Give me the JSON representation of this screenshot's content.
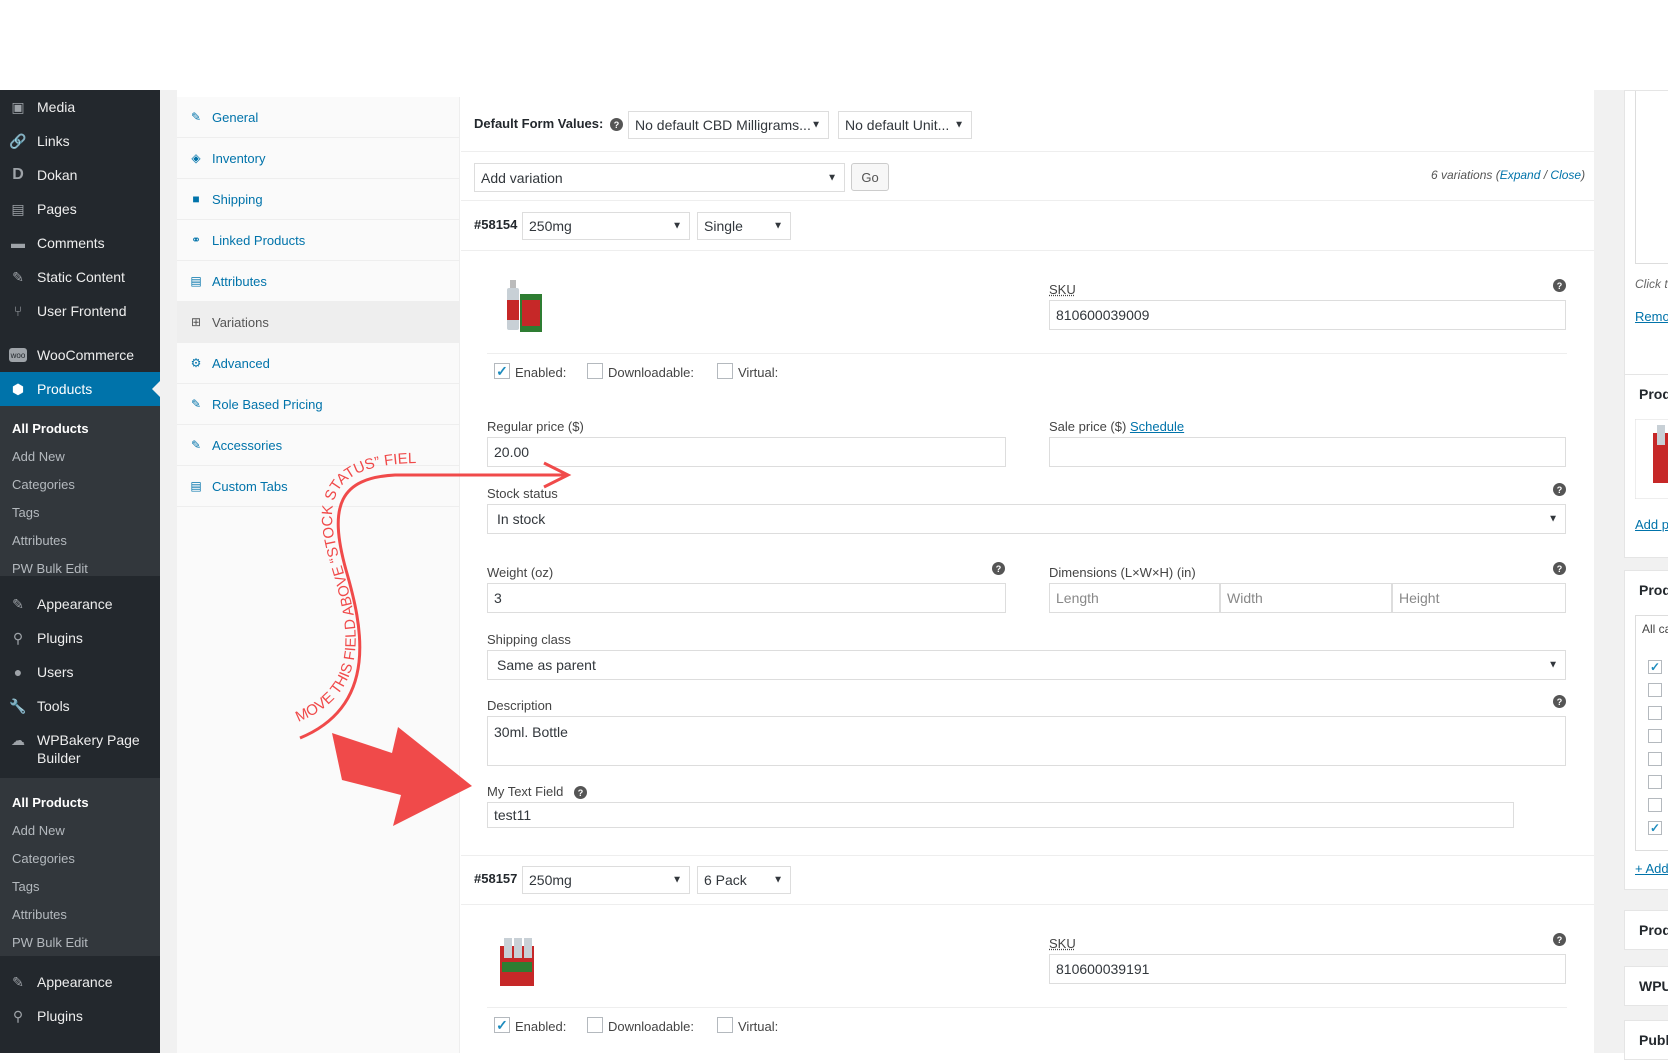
{
  "sidebar": {
    "items": [
      {
        "label": "Media",
        "icon": "media-icon"
      },
      {
        "label": "Links",
        "icon": "links-icon"
      },
      {
        "label": "Dokan",
        "icon": "dokan-icon"
      },
      {
        "label": "Pages",
        "icon": "pages-icon"
      },
      {
        "label": "Comments",
        "icon": "comments-icon"
      },
      {
        "label": "Static Content",
        "icon": "pin-icon"
      },
      {
        "label": "User Frontend",
        "icon": "user-frontend-icon"
      },
      {
        "label": "WooCommerce",
        "icon": "woocommerce-icon"
      },
      {
        "label": "Products",
        "icon": "products-icon"
      }
    ],
    "products_sub": [
      "All Products",
      "Add New",
      "Categories",
      "Tags",
      "Attributes",
      "PW Bulk Edit"
    ],
    "items2": [
      {
        "label": "Appearance",
        "icon": "appearance-icon"
      },
      {
        "label": "Plugins",
        "icon": "plugins-icon"
      },
      {
        "label": "Users",
        "icon": "users-icon"
      },
      {
        "label": "Tools",
        "icon": "tools-icon"
      },
      {
        "label": "WPBakery Page",
        "label2": "Builder",
        "icon": "wpbakery-icon"
      }
    ],
    "wpbakery_sub": [
      "All Products",
      "Add New",
      "Categories",
      "Tags",
      "Attributes",
      "PW Bulk Edit"
    ],
    "items3": [
      {
        "label": "Appearance",
        "icon": "appearance-icon"
      },
      {
        "label": "Plugins",
        "icon": "plugins-icon"
      }
    ]
  },
  "tabs": [
    "General",
    "Inventory",
    "Shipping",
    "Linked Products",
    "Attributes",
    "Variations",
    "Advanced",
    "Role Based Pricing",
    "Accessories",
    "Custom Tabs"
  ],
  "defaults": {
    "label": "Default Form Values:",
    "select1": "No default CBD Milligrams...",
    "select2": "No default Unit..."
  },
  "add_variation": {
    "select": "Add variation",
    "go": "Go",
    "count": "6 variations (",
    "expand": "Expand",
    "slash": " / ",
    "close": "Close",
    "end": ")"
  },
  "var1": {
    "id": "#58154",
    "size": "250mg",
    "unit": "Single",
    "sku_label": "SKU",
    "sku": "810600039009",
    "enabled": "Enabled:",
    "downloadable": "Downloadable:",
    "virtual": "Virtual:",
    "regular_label": "Regular price ($)",
    "regular": "20.00",
    "sale_label": "Sale price ($)",
    "schedule": "Schedule",
    "stock_label": "Stock status",
    "stock": "In stock",
    "weight_label": "Weight (oz)",
    "weight": "3",
    "dims_label": "Dimensions (L×W×H) (in)",
    "length": "Length",
    "width": "Width",
    "height": "Height",
    "shipping_label": "Shipping class",
    "shipping": "Same as parent",
    "desc_label": "Description",
    "desc": "30ml. Bottle",
    "mytext_label": "My Text Field",
    "mytext": "test11"
  },
  "var2": {
    "id": "#58157",
    "size": "250mg",
    "unit": "6 Pack",
    "sku_label": "SKU",
    "sku": "810600039191",
    "enabled": "Enabled:",
    "downloadable": "Downloadable:",
    "virtual": "Virtual:"
  },
  "annotation": {
    "text": "MOVE THIS FIELD ABOVE “STOCK STATUS”  FIELD.",
    "color": "#f04a4a"
  },
  "right": {
    "click": "Click t",
    "remove": "Remo",
    "produ1": "Produ",
    "addp": "Add p",
    "produ2": "Produ",
    "allc": "All ca",
    "add": "+ Add",
    "produ3": "Produ",
    "wpuf": "WPUF",
    "publi": "Publi"
  },
  "colors": {
    "accent": "#0073aa",
    "sidebar": "#23282d",
    "arrow": "#f04a4a"
  }
}
